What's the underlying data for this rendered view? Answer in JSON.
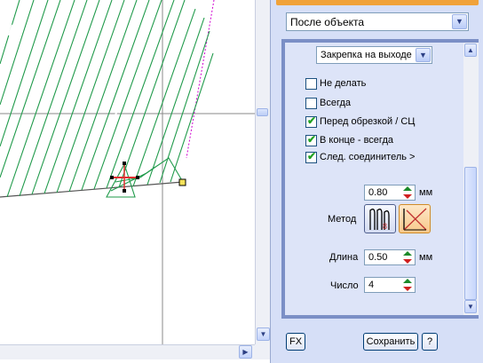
{
  "panel": {
    "position_select": "После объекта",
    "tack_select": "Закрепка на выходе",
    "options": [
      {
        "label": "Не делать",
        "checked": false
      },
      {
        "label": "Всегда",
        "checked": false
      },
      {
        "label": "Перед обрезкой / СЦ",
        "checked": true
      },
      {
        "label": "В конце - всегда",
        "checked": true
      },
      {
        "label": "След. соединитель >",
        "checked": true
      }
    ],
    "offset_value": "0.80",
    "offset_unit": "мм",
    "method_label": "Метод",
    "length_label": "Длина",
    "length_value": "0.50",
    "length_unit": "мм",
    "count_label": "Число",
    "count_value": "4",
    "fx_button": "FX",
    "save_button": "Сохранить",
    "help_button": "?"
  },
  "colors": {
    "stitch": "#1f9a4a",
    "guide": "#808080",
    "connector": "#d000d0",
    "selection": "#e03030",
    "accent": "#f0a23a"
  },
  "icons": {
    "scroll_down": "▼",
    "scroll_up": "▲",
    "scroll_right": "▶",
    "combo_arrow": "▼",
    "check": "✔"
  }
}
